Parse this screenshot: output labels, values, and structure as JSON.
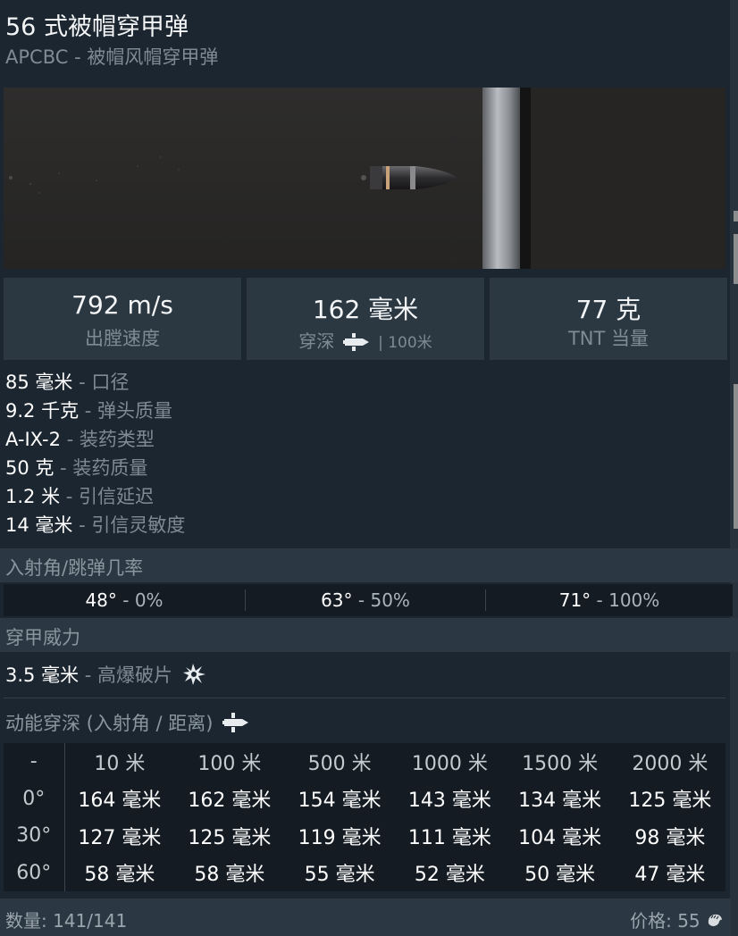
{
  "header": {
    "title": "56 式被帽穿甲弹",
    "subtitle": "APCBC - 被帽风帽穿甲弹"
  },
  "stats": {
    "velocity": {
      "value": "792 m/s",
      "label": "出膛速度"
    },
    "penetration": {
      "value": "162 毫米",
      "label": "穿深",
      "distance": "| 100米"
    },
    "tnt": {
      "value": "77 克",
      "label": "TNT 当量"
    }
  },
  "properties": [
    {
      "value": "85 毫米",
      "desc": " - 口径"
    },
    {
      "value": "9.2 千克",
      "desc": " - 弹头质量"
    },
    {
      "value": "A-IX-2",
      "desc": " - 装药类型"
    },
    {
      "value": "50 克",
      "desc": " - 装药质量"
    },
    {
      "value": "1.2 米",
      "desc": " - 引信延迟"
    },
    {
      "value": "14 毫米",
      "desc": " - 引信灵敏度"
    }
  ],
  "ricochet": {
    "title": "入射角/跳弹几率",
    "cells": [
      {
        "angle": "48°",
        "chance": " - 0%"
      },
      {
        "angle": "63°",
        "chance": " - 50%"
      },
      {
        "angle": "71°",
        "chance": " - 100%"
      }
    ]
  },
  "armor_power": {
    "title": "穿甲威力",
    "he": {
      "value": "3.5 毫米",
      "desc": " - 高爆破片"
    },
    "kinetic_title": "动能穿深 (入射角 / 距离)"
  },
  "pen_table": {
    "corner": "-",
    "distances": [
      "10 米",
      "100 米",
      "500 米",
      "1000 米",
      "1500 米",
      "2000 米"
    ],
    "rows": [
      {
        "angle": "0°",
        "values": [
          "164 毫米",
          "162 毫米",
          "154 毫米",
          "143 毫米",
          "134 毫米",
          "125 毫米"
        ]
      },
      {
        "angle": "30°",
        "values": [
          "127 毫米",
          "125 毫米",
          "119 毫米",
          "111 毫米",
          "104 毫米",
          "98 毫米"
        ]
      },
      {
        "angle": "60°",
        "values": [
          "58 毫米",
          "58 毫米",
          "55 毫米",
          "52 毫米",
          "50 毫米",
          "47 毫米"
        ]
      }
    ]
  },
  "footer": {
    "quantity": "数量: 141/141",
    "price": "价格: 55"
  },
  "icons": [
    "shell-icon",
    "he-fragment-icon",
    "silver-lion-icon"
  ]
}
